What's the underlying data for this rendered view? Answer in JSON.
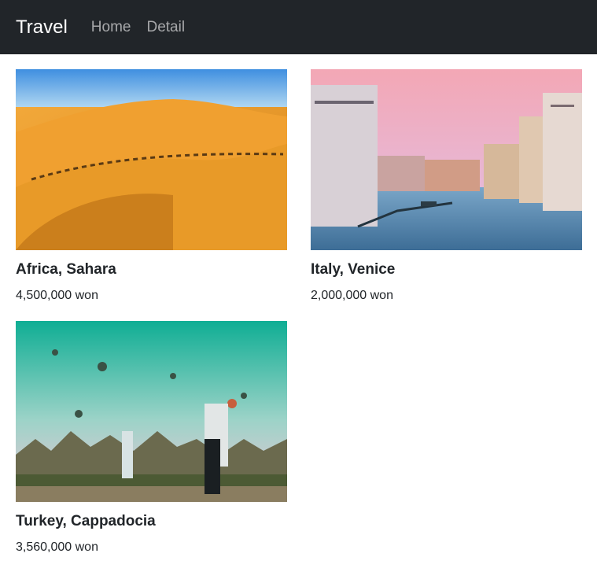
{
  "navbar": {
    "brand": "Travel",
    "links": [
      "Home",
      "Detail"
    ]
  },
  "products": [
    {
      "title": "Africa, Sahara",
      "price": "4,500,000 won",
      "image": "sahara-desert-camel-caravan-photo"
    },
    {
      "title": "Italy, Venice",
      "price": "2,000,000 won",
      "image": "venice-grand-canal-photo"
    },
    {
      "title": "Turkey, Cappadocia",
      "price": "3,560,000 won",
      "image": "cappadocia-hot-air-balloons-photo"
    }
  ]
}
